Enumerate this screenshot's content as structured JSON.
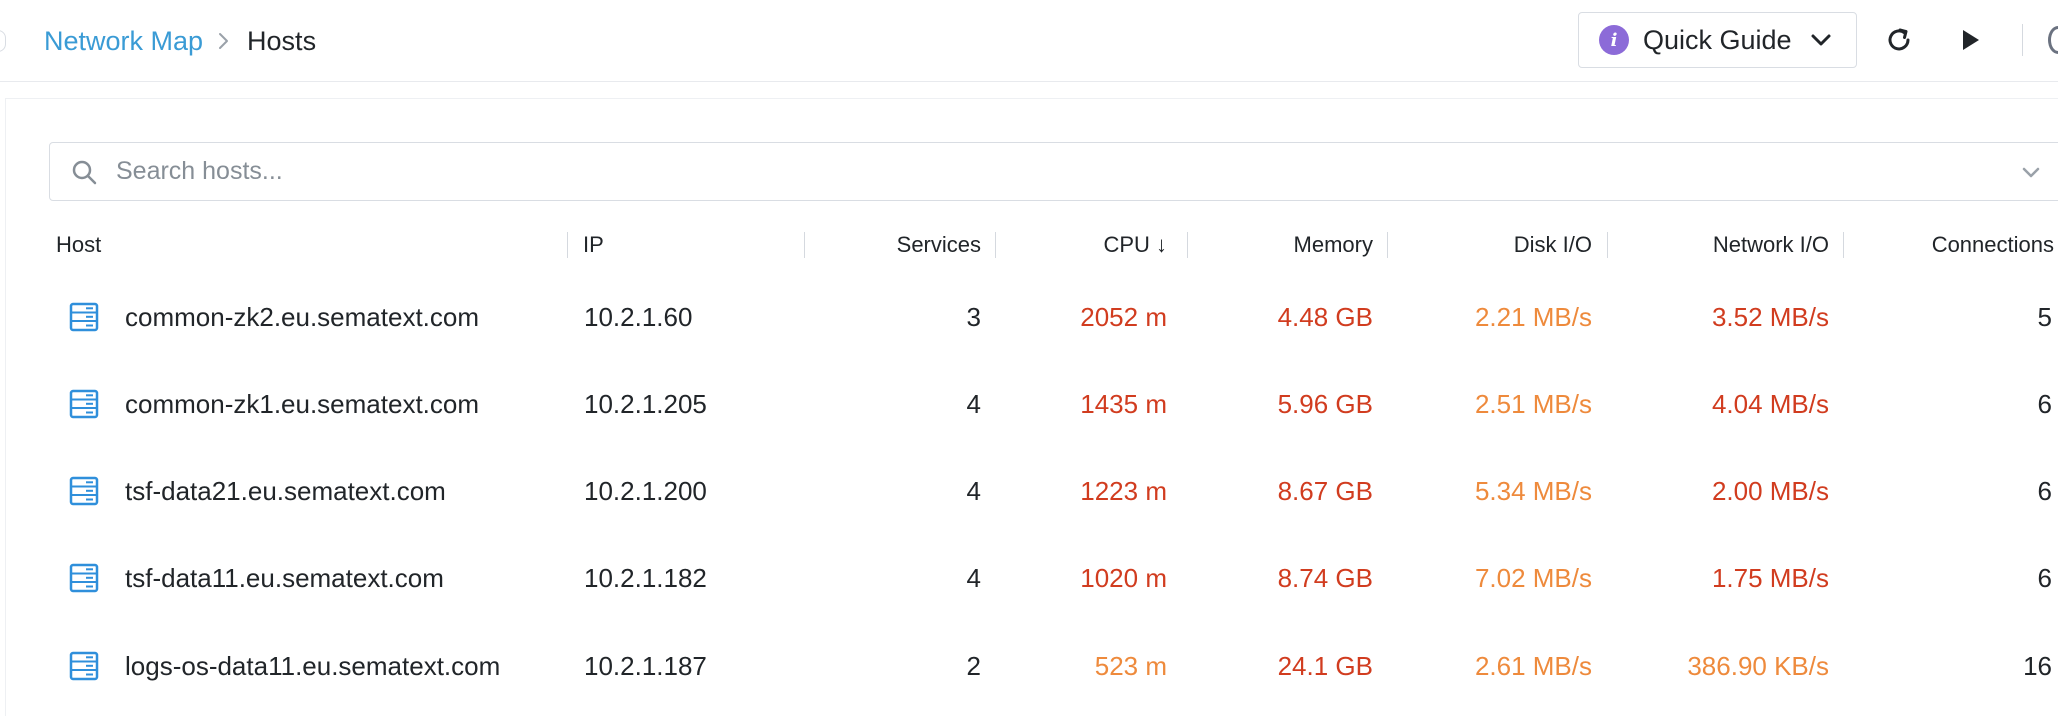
{
  "breadcrumb": {
    "parent": "Network Map",
    "current": "Hosts"
  },
  "toolbar": {
    "quick_guide_label": "Quick Guide",
    "info_glyph": "i",
    "icons": [
      "info-icon",
      "chevron-down-icon",
      "refresh-icon",
      "play-icon"
    ]
  },
  "search": {
    "placeholder": "Search hosts..."
  },
  "table": {
    "columns": {
      "host": "Host",
      "ip": "IP",
      "services": "Services",
      "cpu": "CPU ↓",
      "memory": "Memory",
      "disk": "Disk I/O",
      "network": "Network I/O",
      "connections": "Connections"
    },
    "rows": [
      {
        "host": "common-zk2.eu.sematext.com",
        "ip": "10.2.1.60",
        "services": "3",
        "cpu": "2052 m",
        "cpu_level": "red",
        "memory": "4.48 GB",
        "memory_level": "red",
        "disk": "2.21 MB/s",
        "disk_level": "orange",
        "network": "3.52 MB/s",
        "network_level": "red",
        "connections": "5"
      },
      {
        "host": "common-zk1.eu.sematext.com",
        "ip": "10.2.1.205",
        "services": "4",
        "cpu": "1435 m",
        "cpu_level": "red",
        "memory": "5.96 GB",
        "memory_level": "red",
        "disk": "2.51 MB/s",
        "disk_level": "orange",
        "network": "4.04 MB/s",
        "network_level": "red",
        "connections": "6"
      },
      {
        "host": "tsf-data21.eu.sematext.com",
        "ip": "10.2.1.200",
        "services": "4",
        "cpu": "1223 m",
        "cpu_level": "red",
        "memory": "8.67 GB",
        "memory_level": "red",
        "disk": "5.34 MB/s",
        "disk_level": "orange",
        "network": "2.00 MB/s",
        "network_level": "red",
        "connections": "6"
      },
      {
        "host": "tsf-data11.eu.sematext.com",
        "ip": "10.2.1.182",
        "services": "4",
        "cpu": "1020 m",
        "cpu_level": "red",
        "memory": "8.74 GB",
        "memory_level": "red",
        "disk": "7.02 MB/s",
        "disk_level": "orange",
        "network": "1.75 MB/s",
        "network_level": "red",
        "connections": "6"
      },
      {
        "host": "logs-os-data11.eu.sematext.com",
        "ip": "10.2.1.187",
        "services": "2",
        "cpu": "523 m",
        "cpu_level": "orange",
        "memory": "24.1 GB",
        "memory_level": "red",
        "disk": "2.61 MB/s",
        "disk_level": "orange",
        "network": "386.90 KB/s",
        "network_level": "orange",
        "connections": "16"
      }
    ]
  },
  "colors": {
    "link": "#3a9bd5",
    "red": "#d13c1f",
    "orange": "#ee8a3c",
    "server_icon": "#2f8fdb",
    "info_badge": "#8c6bd8"
  }
}
